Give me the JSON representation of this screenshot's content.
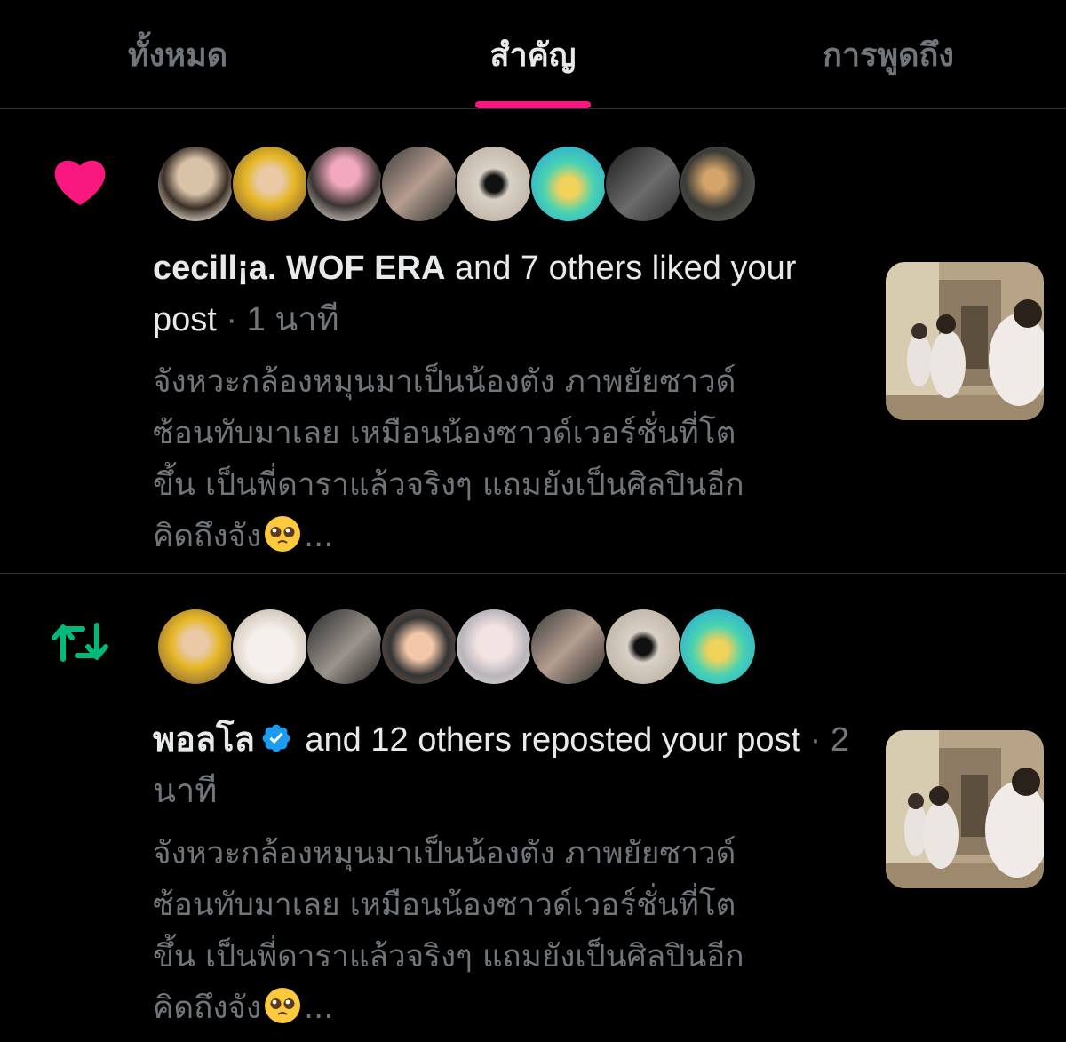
{
  "tabs": [
    {
      "label": "ทั้งหมด",
      "active": false
    },
    {
      "label": "สำคัญ",
      "active": true
    },
    {
      "label": "การพูดถึง",
      "active": false
    }
  ],
  "accent_color": "#f91880",
  "notifications": [
    {
      "type": "like",
      "type_icon": "heart-icon",
      "type_color": "#f91880",
      "actor": "cecill¡a. WOF ERA",
      "action_text": " and 7 others liked your post",
      "separator": " · ",
      "time": "1 นาที",
      "snippet": "จังหวะกล้องหมุนมาเป็นน้องตัง ภาพยัยซาวด์\nซ้อนทับมาเลย เหมือนน้องซาวด์เวอร์ชั่นที่โต\nขึ้น เป็นพี่ดาราแล้วจริงๆ แถมยังเป็นศิลปินอีก\nคิดถึงจัง",
      "ellipsis": "...",
      "emoji": "pleading-face-emoji",
      "avatars": 8
    },
    {
      "type": "repost",
      "type_icon": "repost-icon",
      "type_color": "#00ba7c",
      "actor": "พอลโล",
      "verified": true,
      "action_text": " and 12 others reposted your post",
      "separator": " · ",
      "time": "2 นาที",
      "snippet": "จังหวะกล้องหมุนมาเป็นน้องตัง ภาพยัยซาวด์\nซ้อนทับมาเลย เหมือนน้องซาวด์เวอร์ชั่นที่โต\nขึ้น เป็นพี่ดาราแล้วจริงๆ แถมยังเป็นศิลปินอีก\nคิดถึงจัง",
      "ellipsis": "...",
      "emoji": "pleading-face-emoji",
      "avatars": 8
    }
  ]
}
